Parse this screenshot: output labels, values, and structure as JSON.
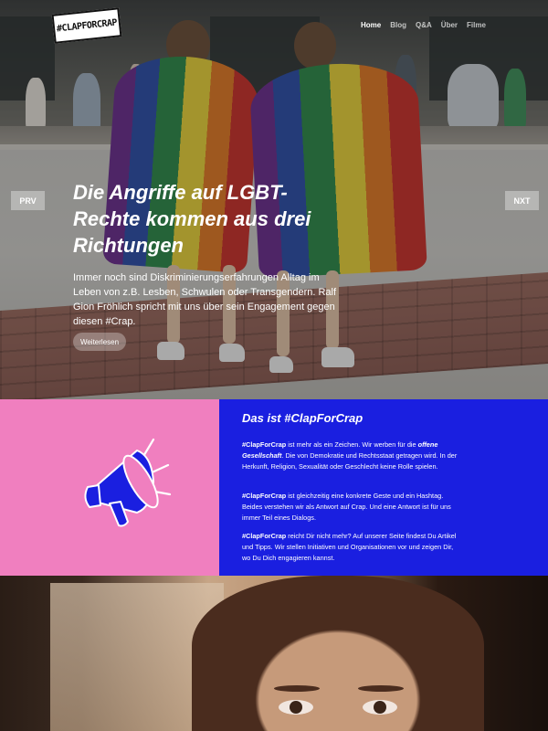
{
  "brand": {
    "logo_text": "#CLAPFORCRAP"
  },
  "nav": {
    "items": [
      {
        "label": "Home",
        "active": true
      },
      {
        "label": "Blog",
        "active": false
      },
      {
        "label": "Q&A",
        "active": false
      },
      {
        "label": "Über",
        "active": false
      },
      {
        "label": "Filme",
        "active": false
      }
    ]
  },
  "hero": {
    "prev_label": "PRV",
    "next_label": "NXT",
    "title": "Die Angriffe auf LGBT-Rechte kommen aus drei Richtungen",
    "subtitle": "Immer noch sind Diskriminierungserfahrungen Alltag im Leben von z.B. Lesben, Schwulen oder Transgendern. Ralf Gion Fröhlich spricht mit uns über sein Engagement gegen diesen #Crap.",
    "cta_label": "Weiterlesen"
  },
  "info": {
    "icon": "megaphone-icon",
    "title": "Das ist #ClapForCrap",
    "paragraphs": [
      {
        "strong": "#ClapForCrap",
        "text": " ist mehr als ein Zeichen. Wir werben für die ",
        "strong2": "offene Gesellschaft",
        "text2": ". Die von Demokratie und Rechtsstaat getragen wird. In der Herkunft, Religion, Sexualität oder Geschlecht keine Rolle spielen."
      },
      {
        "strong": "#ClapForCrap",
        "text": " ist gleichzeitig eine konkrete Geste und ein Hashtag. Beides verstehen wir als Antwort auf Crap. Und eine Antwort ist für uns immer Teil eines Dialogs."
      },
      {
        "strong": "#ClapForCrap",
        "text": " reicht Dir nicht mehr? Auf unserer Seite findest Du Artikel und Tipps. Wir stellen Initiativen und Organisationen vor und zeigen Dir, wo Du Dich engagieren kannst."
      }
    ]
  },
  "colors": {
    "pink": "#f07fbf",
    "blue": "#1a1fe0",
    "white": "#ffffff"
  }
}
